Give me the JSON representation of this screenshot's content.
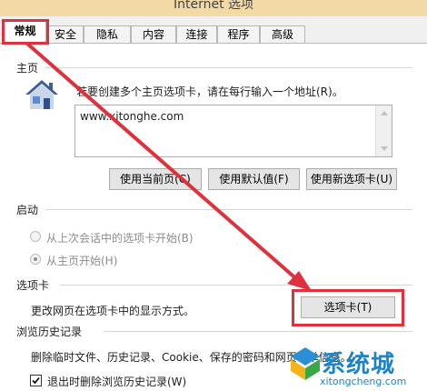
{
  "window": {
    "title": "Internet 选项"
  },
  "tabs": [
    {
      "label": "常规"
    },
    {
      "label": "安全"
    },
    {
      "label": "隐私"
    },
    {
      "label": "内容"
    },
    {
      "label": "连接"
    },
    {
      "label": "程序"
    },
    {
      "label": "高级"
    }
  ],
  "home": {
    "section_label": "主页",
    "description": "若要创建多个主页选项卡，请在每行输入一个地址(R)。",
    "url_value": "www.xitonghe.com",
    "buttons": {
      "current": "使用当前页(C)",
      "default": "使用默认值(F)",
      "new_tab": "使用新选项卡(U)"
    }
  },
  "startup": {
    "section_label": "启动",
    "options": [
      {
        "label": "从上次会话中的选项卡开始(B)",
        "checked": false
      },
      {
        "label": "从主页开始(H)",
        "checked": true
      }
    ]
  },
  "tabs_section": {
    "section_label": "选项卡",
    "description": "更改网页在选项卡中的显示方式。",
    "button": "选项卡(T)"
  },
  "history": {
    "section_label": "浏览历史记录",
    "description": "删除临时文件、历史记录、Cookie、保存的密码和网页表单信息。",
    "delete_on_exit": "退出时删除浏览历史记录(W)",
    "delete_on_exit_checked": true
  },
  "watermark": {
    "text": "系统城",
    "url": "xitongcheng.com"
  },
  "colors": {
    "annotation_red": "#e0303c",
    "watermark_blue": "#1d83c9"
  }
}
